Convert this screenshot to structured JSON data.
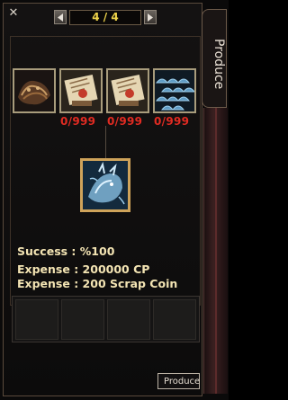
{
  "header": {
    "close_glyph": "✕",
    "page_indicator": "4 / 4"
  },
  "side_tab": {
    "label": "Produce"
  },
  "materials": [
    {
      "icon": "dragon-scale-hide-icon",
      "count": ""
    },
    {
      "icon": "recipe-scroll-icon",
      "count": "0/999"
    },
    {
      "icon": "recipe-scroll-icon",
      "count": "0/999"
    },
    {
      "icon": "blue-scale-icon",
      "count": "0/999"
    }
  ],
  "result": {
    "icon": "blue-dragon-icon"
  },
  "info": {
    "success": "Success : %100",
    "expense_cp": "Expense : 200000 CP",
    "expense_coin": "Expense : 200 Scrap Coin"
  },
  "produce_button": {
    "label": "Produce"
  },
  "colors": {
    "count_red": "#e12b22",
    "page_yellow": "#f0d44a",
    "info_text": "#f3e4b3",
    "result_border": "#cfa35a"
  }
}
